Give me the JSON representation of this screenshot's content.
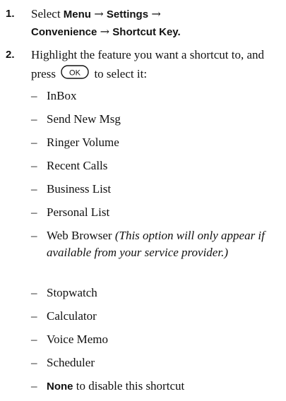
{
  "steps": [
    {
      "number": "1.",
      "text_prefix": "Select ",
      "path": [
        "Menu",
        "Settings",
        "Convenience",
        "Shortcut Key."
      ],
      "arrow": "→"
    },
    {
      "number": "2.",
      "text_before_key": "Highlight the feature you want a shortcut to, and press",
      "text_after_key": "to select it:",
      "key_label": "OK",
      "options": [
        {
          "label": "InBox"
        },
        {
          "label": "Send New Msg"
        },
        {
          "label": "Ringer Volume"
        },
        {
          "label": "Recent Calls"
        },
        {
          "label": "Business List"
        },
        {
          "label": "Personal List"
        },
        {
          "label": "Web Browser",
          "note": "(This option will only appear if available from your service provider.)"
        },
        {
          "label": "Stopwatch"
        },
        {
          "label": "Calculator"
        },
        {
          "label": "Voice Memo"
        },
        {
          "label": "Scheduler"
        },
        {
          "label": "None",
          "suffix": " to disable this shortcut"
        }
      ],
      "dash": "–"
    }
  ]
}
